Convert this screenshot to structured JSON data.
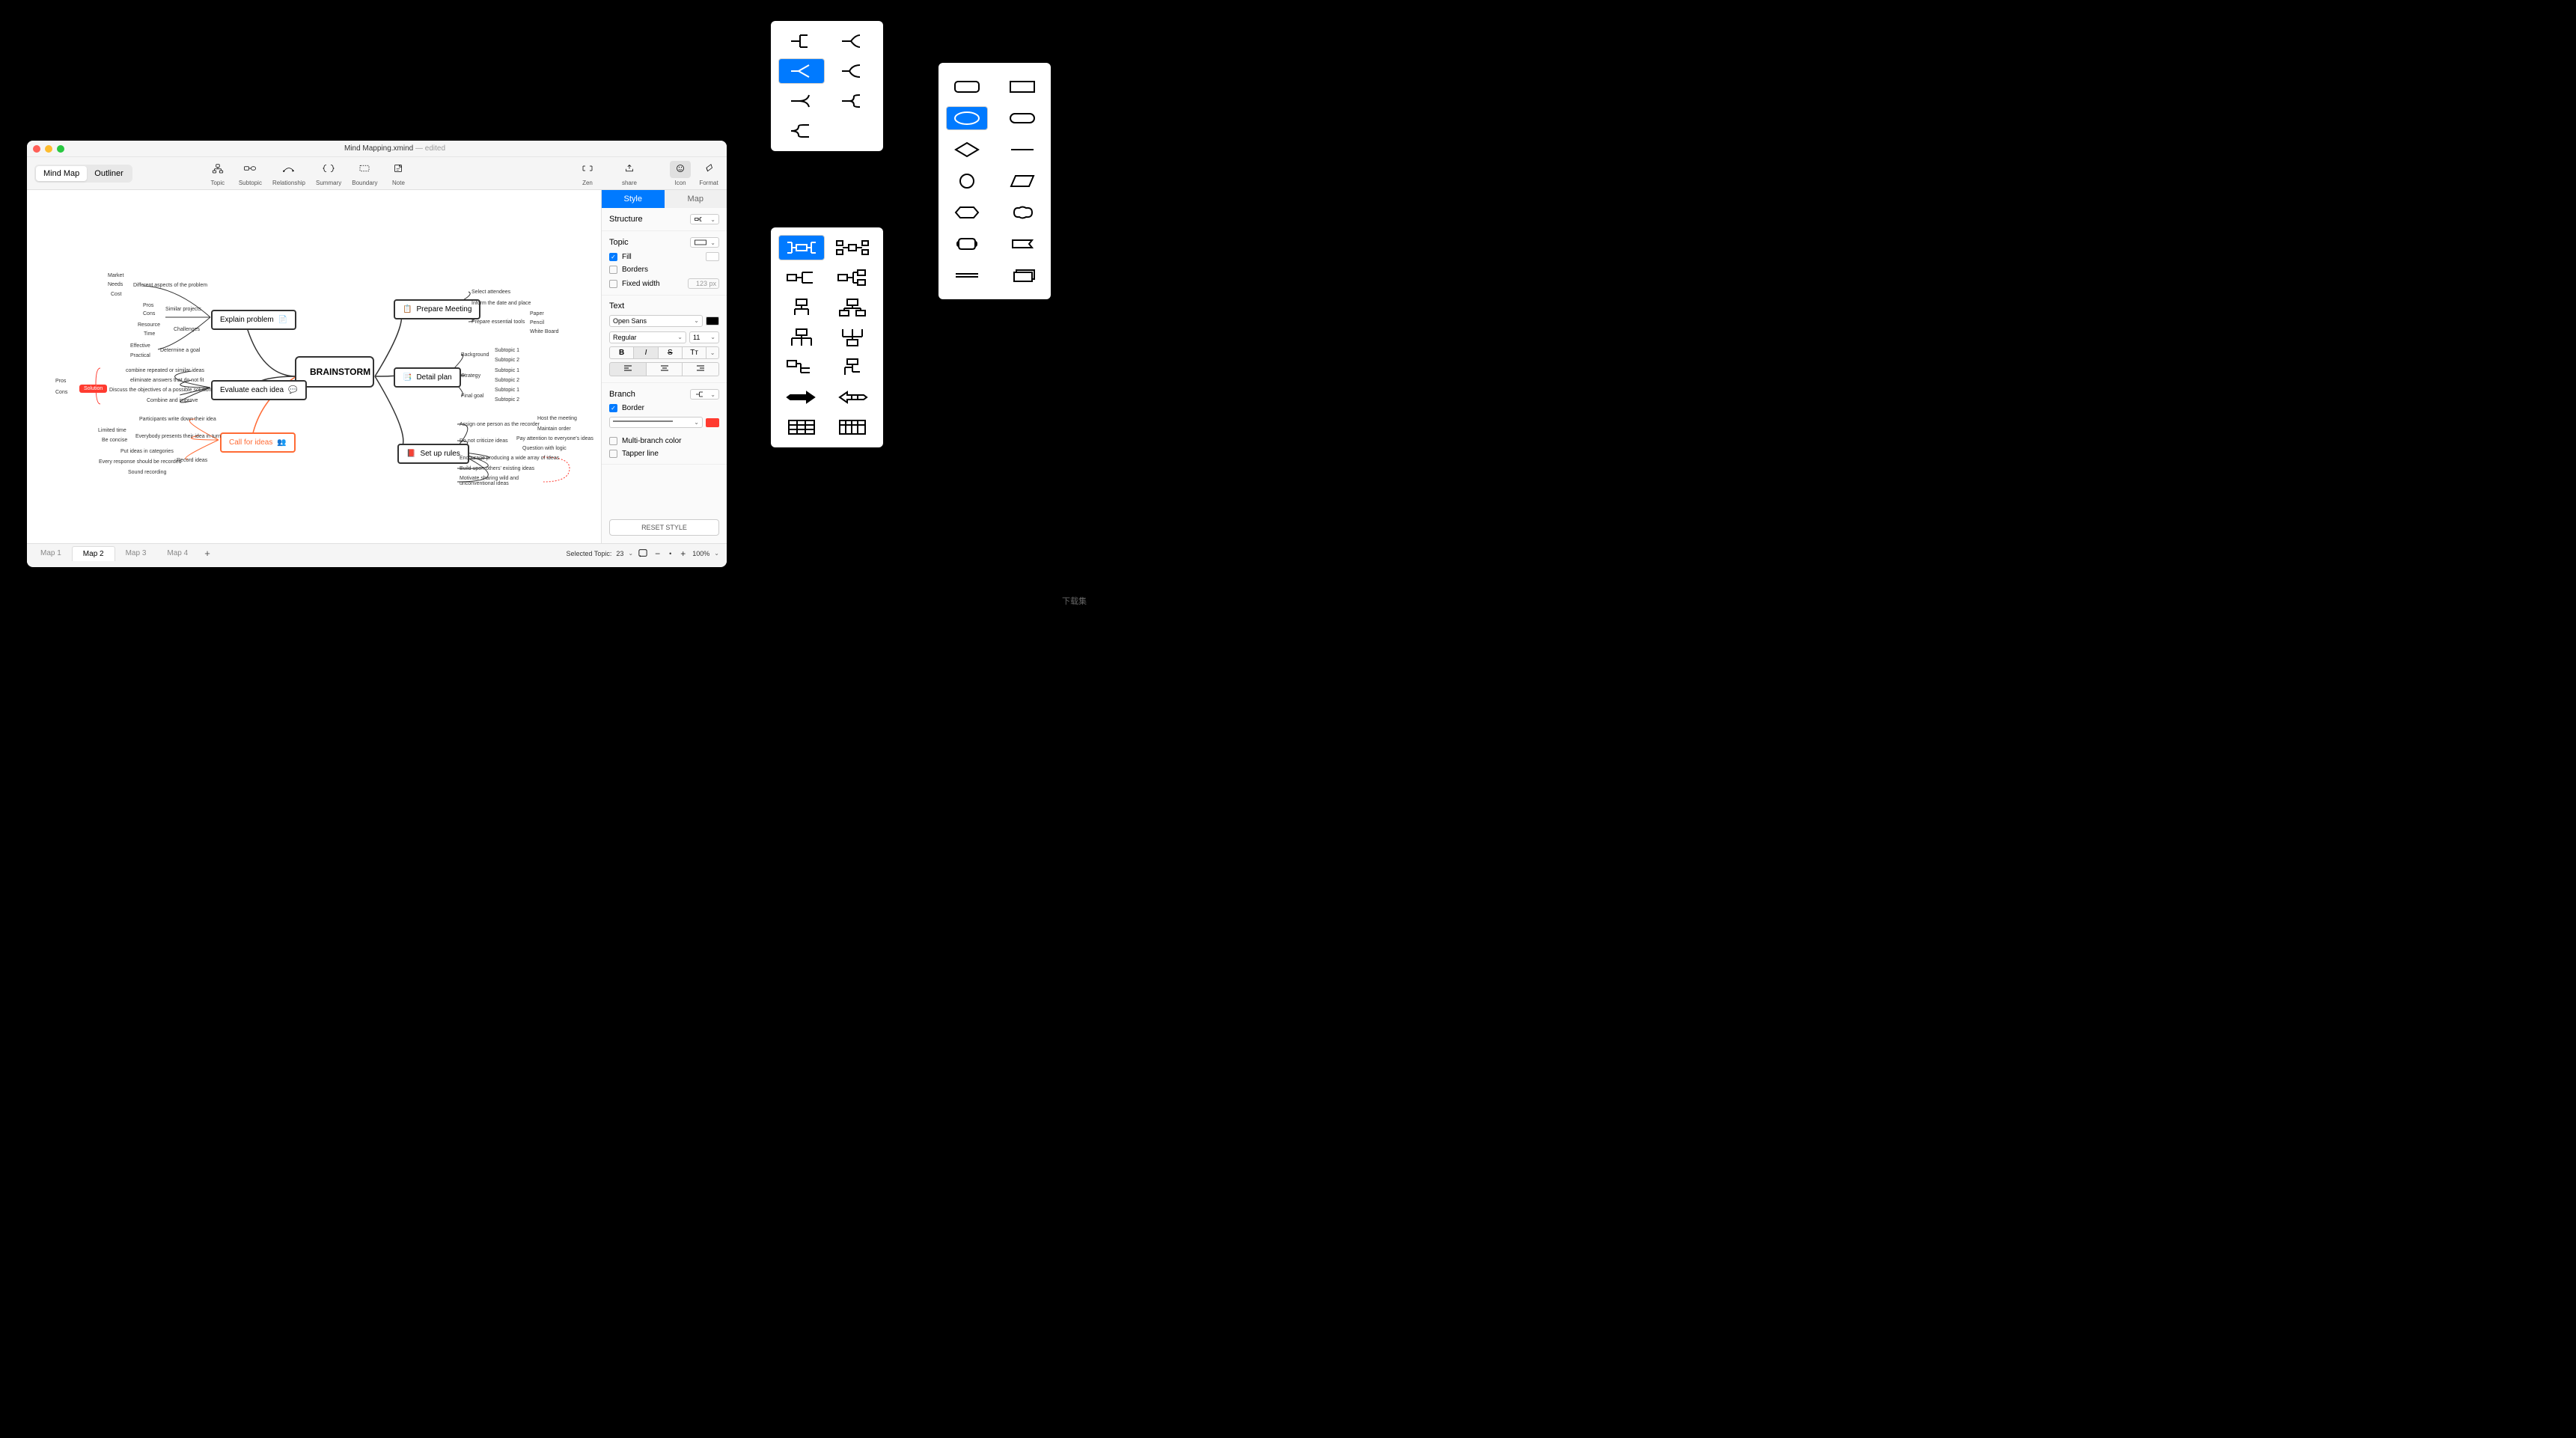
{
  "window": {
    "title": "Mind Mapping.xmind",
    "title_suffix": " — edited"
  },
  "view_toggle": {
    "mindmap": "Mind Map",
    "outliner": "Outliner"
  },
  "tools": {
    "topic": "Topic",
    "subtopic": "Subtopic",
    "relationship": "Relationship",
    "summary": "Summary",
    "boundary": "Boundary",
    "note": "Note",
    "zen": "Zen",
    "share": "share",
    "icon": "Icon",
    "format": "Format"
  },
  "panel": {
    "tabs": {
      "style": "Style",
      "map": "Map"
    },
    "structure": "Structure",
    "topic": "Topic",
    "fill": "Fill",
    "borders": "Borders",
    "fixed_width": "Fixed width",
    "fixed_width_val": "123 px",
    "text": "Text",
    "font": "Open Sans",
    "weight": "Regular",
    "size": "11",
    "branch": "Branch",
    "border": "Border",
    "multi": "Multi-branch color",
    "tapper": "Tapper line",
    "reset": "RESET STYLE"
  },
  "mindmap": {
    "center": "BRAINSTORM",
    "explain": "Explain problem",
    "evaluate": "Evaluate each idea",
    "call": "Call for ideas",
    "prepare": "Prepare Meeting",
    "detail": "Detail plan",
    "rules": "Set up rules",
    "solution": "Solution",
    "left1": [
      "Market",
      "Needs",
      "Cost"
    ],
    "left1_sum": "Different aspects of the problem",
    "left2": [
      "Pros",
      "Cons",
      "Resource",
      "Time"
    ],
    "left2_sim": "Similar projects",
    "left2_chal": "Challenges",
    "left3": [
      "Effective",
      "Practical"
    ],
    "left3_sum": "Determine a goal",
    "eval_left_items": [
      "combine repeated or similar ideas",
      "eliminate answers that do not fit",
      "Discuss the objectives of a possible solution",
      "Combine and improve"
    ],
    "eval_left_tags": [
      "Pros",
      "Cons"
    ],
    "call_left": [
      "Participants write down their idea",
      "Everybody presents their idea in turn",
      "Record ideas"
    ],
    "call_left_tags": [
      "Limited time",
      "Be concise",
      "Put ideas in categories",
      "Every response should be recorded",
      "Sound recording"
    ],
    "prep_right": [
      "Select attendees",
      "Inform the date and place",
      "Prepare essential tools"
    ],
    "prep_tools": [
      "Paper",
      "Pencil",
      "White Board"
    ],
    "detail_right": [
      "Background",
      "Strategy",
      "Final goal"
    ],
    "detail_sub": [
      "Subtopic 1",
      "Subtopic 2",
      "Subtopic 1",
      "Subtopic 2",
      "Subtopic 1",
      "Subtopic 2"
    ],
    "rules_right": [
      "Assign one person as the recorder",
      "Do not criticize ideas",
      "Encourage producing a wide array of ideas",
      "Build upon others' existing ideas",
      "Motivate sharing wild and unconventional ideas"
    ],
    "rules_sub": [
      "Host the meeting",
      "Maintain order",
      "Pay attention to everyone's ideas",
      "Question with logic"
    ]
  },
  "footer": {
    "tabs": [
      "Map 1",
      "Map 2",
      "Map 3",
      "Map 4"
    ],
    "selected": "Selected Topic:",
    "selected_n": "23",
    "zoom": "100%"
  },
  "watermark": "下载集"
}
